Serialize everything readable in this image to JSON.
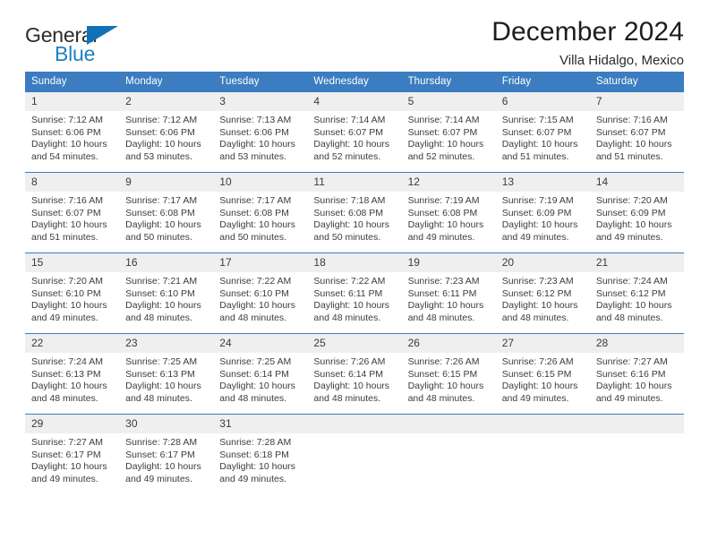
{
  "brand": {
    "name_part1": "General",
    "name_part2": "Blue",
    "logo_icon": "triangle-logo-icon"
  },
  "header": {
    "month_title": "December 2024",
    "location": "Villa Hidalgo, Mexico"
  },
  "colors": {
    "header_blue": "#3b7dc0",
    "daynum_band": "#efefef",
    "brand_blue": "#1f7fc4",
    "text": "#3c3c3c"
  },
  "weekdays": [
    "Sunday",
    "Monday",
    "Tuesday",
    "Wednesday",
    "Thursday",
    "Friday",
    "Saturday"
  ],
  "weeks": [
    [
      {
        "day": "1",
        "sunrise": "Sunrise: 7:12 AM",
        "sunset": "Sunset: 6:06 PM",
        "daylight_line1": "Daylight: 10 hours",
        "daylight_line2": "and 54 minutes."
      },
      {
        "day": "2",
        "sunrise": "Sunrise: 7:12 AM",
        "sunset": "Sunset: 6:06 PM",
        "daylight_line1": "Daylight: 10 hours",
        "daylight_line2": "and 53 minutes."
      },
      {
        "day": "3",
        "sunrise": "Sunrise: 7:13 AM",
        "sunset": "Sunset: 6:06 PM",
        "daylight_line1": "Daylight: 10 hours",
        "daylight_line2": "and 53 minutes."
      },
      {
        "day": "4",
        "sunrise": "Sunrise: 7:14 AM",
        "sunset": "Sunset: 6:07 PM",
        "daylight_line1": "Daylight: 10 hours",
        "daylight_line2": "and 52 minutes."
      },
      {
        "day": "5",
        "sunrise": "Sunrise: 7:14 AM",
        "sunset": "Sunset: 6:07 PM",
        "daylight_line1": "Daylight: 10 hours",
        "daylight_line2": "and 52 minutes."
      },
      {
        "day": "6",
        "sunrise": "Sunrise: 7:15 AM",
        "sunset": "Sunset: 6:07 PM",
        "daylight_line1": "Daylight: 10 hours",
        "daylight_line2": "and 51 minutes."
      },
      {
        "day": "7",
        "sunrise": "Sunrise: 7:16 AM",
        "sunset": "Sunset: 6:07 PM",
        "daylight_line1": "Daylight: 10 hours",
        "daylight_line2": "and 51 minutes."
      }
    ],
    [
      {
        "day": "8",
        "sunrise": "Sunrise: 7:16 AM",
        "sunset": "Sunset: 6:07 PM",
        "daylight_line1": "Daylight: 10 hours",
        "daylight_line2": "and 51 minutes."
      },
      {
        "day": "9",
        "sunrise": "Sunrise: 7:17 AM",
        "sunset": "Sunset: 6:08 PM",
        "daylight_line1": "Daylight: 10 hours",
        "daylight_line2": "and 50 minutes."
      },
      {
        "day": "10",
        "sunrise": "Sunrise: 7:17 AM",
        "sunset": "Sunset: 6:08 PM",
        "daylight_line1": "Daylight: 10 hours",
        "daylight_line2": "and 50 minutes."
      },
      {
        "day": "11",
        "sunrise": "Sunrise: 7:18 AM",
        "sunset": "Sunset: 6:08 PM",
        "daylight_line1": "Daylight: 10 hours",
        "daylight_line2": "and 50 minutes."
      },
      {
        "day": "12",
        "sunrise": "Sunrise: 7:19 AM",
        "sunset": "Sunset: 6:08 PM",
        "daylight_line1": "Daylight: 10 hours",
        "daylight_line2": "and 49 minutes."
      },
      {
        "day": "13",
        "sunrise": "Sunrise: 7:19 AM",
        "sunset": "Sunset: 6:09 PM",
        "daylight_line1": "Daylight: 10 hours",
        "daylight_line2": "and 49 minutes."
      },
      {
        "day": "14",
        "sunrise": "Sunrise: 7:20 AM",
        "sunset": "Sunset: 6:09 PM",
        "daylight_line1": "Daylight: 10 hours",
        "daylight_line2": "and 49 minutes."
      }
    ],
    [
      {
        "day": "15",
        "sunrise": "Sunrise: 7:20 AM",
        "sunset": "Sunset: 6:10 PM",
        "daylight_line1": "Daylight: 10 hours",
        "daylight_line2": "and 49 minutes."
      },
      {
        "day": "16",
        "sunrise": "Sunrise: 7:21 AM",
        "sunset": "Sunset: 6:10 PM",
        "daylight_line1": "Daylight: 10 hours",
        "daylight_line2": "and 48 minutes."
      },
      {
        "day": "17",
        "sunrise": "Sunrise: 7:22 AM",
        "sunset": "Sunset: 6:10 PM",
        "daylight_line1": "Daylight: 10 hours",
        "daylight_line2": "and 48 minutes."
      },
      {
        "day": "18",
        "sunrise": "Sunrise: 7:22 AM",
        "sunset": "Sunset: 6:11 PM",
        "daylight_line1": "Daylight: 10 hours",
        "daylight_line2": "and 48 minutes."
      },
      {
        "day": "19",
        "sunrise": "Sunrise: 7:23 AM",
        "sunset": "Sunset: 6:11 PM",
        "daylight_line1": "Daylight: 10 hours",
        "daylight_line2": "and 48 minutes."
      },
      {
        "day": "20",
        "sunrise": "Sunrise: 7:23 AM",
        "sunset": "Sunset: 6:12 PM",
        "daylight_line1": "Daylight: 10 hours",
        "daylight_line2": "and 48 minutes."
      },
      {
        "day": "21",
        "sunrise": "Sunrise: 7:24 AM",
        "sunset": "Sunset: 6:12 PM",
        "daylight_line1": "Daylight: 10 hours",
        "daylight_line2": "and 48 minutes."
      }
    ],
    [
      {
        "day": "22",
        "sunrise": "Sunrise: 7:24 AM",
        "sunset": "Sunset: 6:13 PM",
        "daylight_line1": "Daylight: 10 hours",
        "daylight_line2": "and 48 minutes."
      },
      {
        "day": "23",
        "sunrise": "Sunrise: 7:25 AM",
        "sunset": "Sunset: 6:13 PM",
        "daylight_line1": "Daylight: 10 hours",
        "daylight_line2": "and 48 minutes."
      },
      {
        "day": "24",
        "sunrise": "Sunrise: 7:25 AM",
        "sunset": "Sunset: 6:14 PM",
        "daylight_line1": "Daylight: 10 hours",
        "daylight_line2": "and 48 minutes."
      },
      {
        "day": "25",
        "sunrise": "Sunrise: 7:26 AM",
        "sunset": "Sunset: 6:14 PM",
        "daylight_line1": "Daylight: 10 hours",
        "daylight_line2": "and 48 minutes."
      },
      {
        "day": "26",
        "sunrise": "Sunrise: 7:26 AM",
        "sunset": "Sunset: 6:15 PM",
        "daylight_line1": "Daylight: 10 hours",
        "daylight_line2": "and 48 minutes."
      },
      {
        "day": "27",
        "sunrise": "Sunrise: 7:26 AM",
        "sunset": "Sunset: 6:15 PM",
        "daylight_line1": "Daylight: 10 hours",
        "daylight_line2": "and 49 minutes."
      },
      {
        "day": "28",
        "sunrise": "Sunrise: 7:27 AM",
        "sunset": "Sunset: 6:16 PM",
        "daylight_line1": "Daylight: 10 hours",
        "daylight_line2": "and 49 minutes."
      }
    ],
    [
      {
        "day": "29",
        "sunrise": "Sunrise: 7:27 AM",
        "sunset": "Sunset: 6:17 PM",
        "daylight_line1": "Daylight: 10 hours",
        "daylight_line2": "and 49 minutes."
      },
      {
        "day": "30",
        "sunrise": "Sunrise: 7:28 AM",
        "sunset": "Sunset: 6:17 PM",
        "daylight_line1": "Daylight: 10 hours",
        "daylight_line2": "and 49 minutes."
      },
      {
        "day": "31",
        "sunrise": "Sunrise: 7:28 AM",
        "sunset": "Sunset: 6:18 PM",
        "daylight_line1": "Daylight: 10 hours",
        "daylight_line2": "and 49 minutes."
      },
      {
        "day": "",
        "sunrise": "",
        "sunset": "",
        "daylight_line1": "",
        "daylight_line2": ""
      },
      {
        "day": "",
        "sunrise": "",
        "sunset": "",
        "daylight_line1": "",
        "daylight_line2": ""
      },
      {
        "day": "",
        "sunrise": "",
        "sunset": "",
        "daylight_line1": "",
        "daylight_line2": ""
      },
      {
        "day": "",
        "sunrise": "",
        "sunset": "",
        "daylight_line1": "",
        "daylight_line2": ""
      }
    ]
  ]
}
